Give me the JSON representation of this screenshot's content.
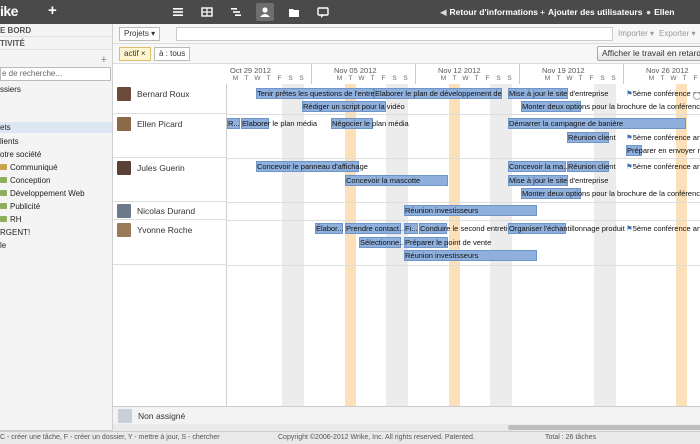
{
  "topbar": {
    "logo": "ike",
    "plus": "+",
    "icons": [
      "list-icon",
      "table-icon",
      "gantt-icon",
      "person-icon",
      "folder-icon",
      "chat-icon"
    ],
    "links": [
      "Retour d'informations",
      "Ajouter des utilisateurs",
      "Ellen"
    ]
  },
  "sidebar": {
    "heads": [
      "E BORD",
      "TIVITÉ"
    ],
    "search": "e de recherche...",
    "items": [
      "ssiers",
      "",
      "ets",
      "lients",
      "otre société",
      "Communiqué",
      "Conception",
      "Développement Web",
      "Publicité",
      "RH",
      "RGENT!",
      "le"
    ]
  },
  "toolbar": {
    "projects": "Projets",
    "import": "Importer",
    "export": "Exporter",
    "chip_active": "actif",
    "chip_active_close": "×",
    "chip_all": "à : tous",
    "show_late": "Afficher le travail en retard"
  },
  "gantt": {
    "weeks": [
      "Oct 29 2012",
      "Nov 05 2012",
      "Nov 12 2012",
      "Nov 19 2012",
      "Nov 26 2012"
    ],
    "day_letters": [
      "M",
      "T",
      "W",
      "T",
      "F",
      "S",
      "S"
    ],
    "people": [
      "Bernard Roux",
      "Ellen Picard",
      "Jules Guerin",
      "Nicolas Durand",
      "Yvonne Roche"
    ],
    "tasks": {
      "bernard": [
        "Tenir prêtes les questions de l'entretien",
        "Elaborer le plan de développement de l'id...",
        "Rédiger un script pour la vidéo",
        "Mise à jour le site d'entreprise",
        "Monter deux options pour la brochure de la conférence",
        "5ème conférence annu"
      ],
      "ellen": [
        "R...",
        "Elaborer le plan média",
        "Négocier le plan média",
        "Démarrer la campagne de banière",
        "Réunion client",
        "5ème conférence annu",
        "Préparer en envoyer not"
      ],
      "jules": [
        "Concevoir le panneau d'affichage",
        "Concevoir la mascotte",
        "Concevoir la ma...",
        "Réunion client",
        "Mise à jour le site d'entreprise",
        "Monter deux options pour la brochure de la conférence",
        "5ème conférence annu"
      ],
      "nicolas": [
        "Réunion investisseurs"
      ],
      "yvonne": [
        "Élabor...",
        "Prendre contact...",
        "Fi...",
        "Conduire le second entretien",
        "Organiser l'échantillonnage produit",
        "Sélectionne...",
        "Préparer le point de vente",
        "Réunion investisseurs",
        "5ème conférence annu"
      ]
    },
    "unassigned": "Non assigné"
  },
  "status": {
    "shortcuts": "C - créer une tâche, F - créer un dossier, Y - mettre à jour, S - chercher",
    "copyright": "Copyright ©2006-2012 Wrike, Inc. All rights reserved. Patented.",
    "total": "Total : 26 tâches"
  },
  "colors": {
    "bar": "#8fb0dd",
    "today": "#fbe0b9",
    "topbar": "#4a4a4a"
  }
}
